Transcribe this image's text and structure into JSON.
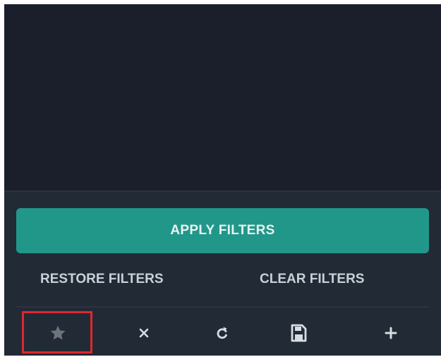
{
  "filters": {
    "apply_label": "APPLY FILTERS",
    "restore_label": "RESTORE FILTERS",
    "clear_label": "CLEAR FILTERS"
  },
  "toolbar": {
    "icons": [
      "star-icon",
      "close-icon",
      "refresh-icon",
      "save-icon",
      "plus-icon"
    ]
  },
  "colors": {
    "background": "#1a1f2b",
    "panel": "#222a35",
    "accent": "#21978a",
    "text": "#c9d0d8",
    "highlight": "#e0272d"
  }
}
